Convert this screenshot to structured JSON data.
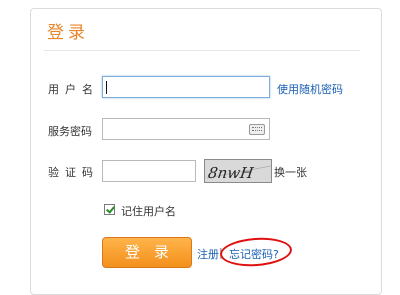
{
  "title": "登录",
  "labels": {
    "username": "用户名",
    "password": "服务密码",
    "captcha": "验证码"
  },
  "links": {
    "random_password": "使用随机密码",
    "refresh_captcha": "换一张",
    "register": "注册",
    "separator": "|",
    "forgot_password": "忘记密码?"
  },
  "captcha_text": "8nwH",
  "remember_label": "记住用户名",
  "remember_checked": true,
  "login_button": "登录",
  "colors": {
    "accent": "#e8862a",
    "link": "#1a5fb4",
    "annotation": "#e01010"
  }
}
